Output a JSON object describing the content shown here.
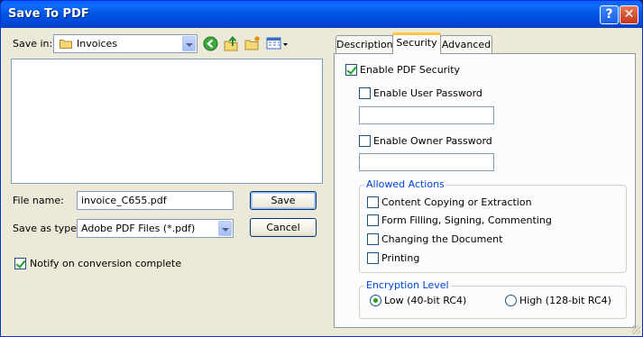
{
  "window": {
    "title": "Save To PDF",
    "help_label": "?",
    "close_label": "✕"
  },
  "save_in": {
    "label": "Save in:",
    "value": "Invoices",
    "toolbar_icons": [
      "back-icon",
      "up-folder-icon",
      "new-folder-icon",
      "view-menu-icon"
    ]
  },
  "file_name": {
    "label": "File name:",
    "value": "invoice_C655.pdf"
  },
  "save_as_type": {
    "label": "Save as type:",
    "value": "Adobe PDF Files (*.pdf)"
  },
  "buttons": {
    "save": "Save",
    "cancel": "Cancel"
  },
  "notify": {
    "label": "Notify on conversion complete",
    "checked": true
  },
  "tabs": [
    {
      "label": "Description",
      "active": false
    },
    {
      "label": "Security",
      "active": true
    },
    {
      "label": "Advanced",
      "active": false
    }
  ],
  "security": {
    "enable_pdf_security": {
      "label": "Enable PDF Security",
      "checked": true
    },
    "enable_user_password": {
      "label": "Enable User Password",
      "checked": false,
      "value": ""
    },
    "enable_owner_password": {
      "label": "Enable Owner Password",
      "checked": false,
      "value": ""
    },
    "allowed_actions": {
      "title": "Allowed Actions",
      "items": [
        {
          "label": "Content Copying or Extraction",
          "checked": false
        },
        {
          "label": "Form Filling, Signing, Commenting",
          "checked": false
        },
        {
          "label": "Changing the Document",
          "checked": false
        },
        {
          "label": "Printing",
          "checked": false
        }
      ]
    },
    "encryption_level": {
      "title": "Encryption Level",
      "options": [
        {
          "label": "Low (40-bit RC4)",
          "selected": true
        },
        {
          "label": "High (128-bit RC4)",
          "selected": false
        }
      ]
    }
  }
}
